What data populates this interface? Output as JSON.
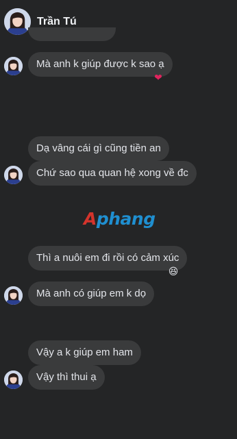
{
  "header": {
    "contact_name": "Trần Tú"
  },
  "messages": [
    {
      "text": "Mà anh k giúp được k sao ạ",
      "reaction": "❤"
    },
    {
      "text": "Dạ vâng cái gì cũng tiền an"
    },
    {
      "text": "Chứ sao qua quan hệ xong về đc"
    },
    {
      "text": "Thì a nuôi em đi rồi có cảm xúc",
      "reaction": "😆"
    },
    {
      "text": "Mà anh có giúp em k dọ"
    },
    {
      "text": "Vậy a k giúp em ham"
    },
    {
      "text": "Vậy thì thui ạ"
    }
  ],
  "watermark": {
    "part1": "A",
    "part2": "phang"
  },
  "colors": {
    "background": "#242526",
    "bubble": "#3a3b3c",
    "text": "#e4e6eb",
    "watermark_red": "#d4342c",
    "watermark_blue": "#1f8fd0"
  }
}
